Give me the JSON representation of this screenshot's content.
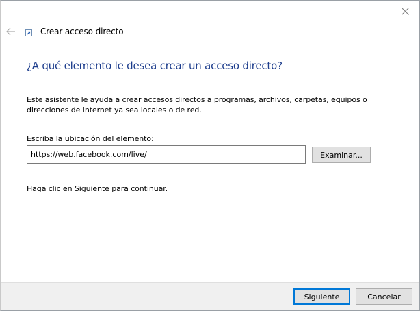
{
  "window": {
    "title": "Crear acceso directo"
  },
  "main": {
    "heading": "¿A qué elemento le desea crear un acceso directo?",
    "description": "Este asistente le ayuda a crear accesos directos a programas, archivos, carpetas, equipos o direcciones de Internet ya sea locales o de red.",
    "location_label": "Escriba la ubicación del elemento:",
    "location_value": "https://web.facebook.com/live/",
    "browse_label": "Examinar...",
    "hint": "Haga clic en Siguiente para continuar."
  },
  "footer": {
    "next_label": "Siguiente",
    "cancel_label": "Cancelar"
  },
  "colors": {
    "heading": "#1c3c8c",
    "default_button_border": "#0078d7",
    "footer_bg": "#f0f0f0"
  },
  "icons": {
    "close": "close-icon",
    "back": "back-arrow-icon",
    "wizard": "shortcut-icon"
  }
}
